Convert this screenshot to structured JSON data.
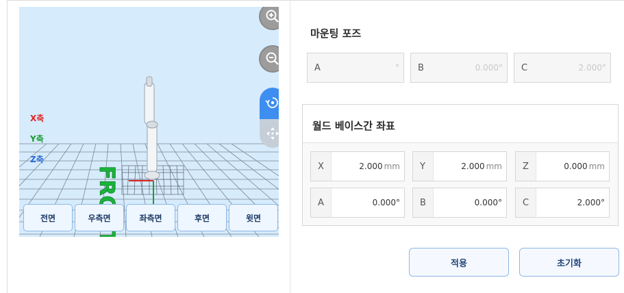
{
  "viewport": {
    "axis_labels": {
      "x": "X축",
      "y": "Y축",
      "z": "Z축"
    },
    "front_marker": "FRONT",
    "controls": [
      "zoom-in-icon",
      "zoom-out-icon",
      "rotate-icon",
      "pan-icon"
    ],
    "view_buttons": [
      "전면",
      "우측면",
      "좌측면",
      "후면",
      "윗면"
    ]
  },
  "mounting_pose": {
    "title": "마운팅 포즈",
    "fields": [
      {
        "label": "A",
        "value": "°"
      },
      {
        "label": "B",
        "value": "0.000°"
      },
      {
        "label": "C",
        "value": "2.000°"
      }
    ]
  },
  "world_base": {
    "title": "월드 베이스간 좌표",
    "row1": [
      {
        "label": "X",
        "value": "2.000",
        "unit": "mm"
      },
      {
        "label": "Y",
        "value": "2.000",
        "unit": "mm"
      },
      {
        "label": "Z",
        "value": "0.000",
        "unit": "mm"
      }
    ],
    "row2": [
      {
        "label": "A",
        "value": "0.000°"
      },
      {
        "label": "B",
        "value": "0.000°"
      },
      {
        "label": "C",
        "value": "2.000°"
      }
    ]
  },
  "actions": {
    "apply": "적용",
    "reset": "초기화"
  },
  "colors": {
    "accent": "#3d8ef0",
    "axis_x": "#e02424",
    "axis_y": "#1b9c2e",
    "axis_z": "#2a6ad8"
  }
}
